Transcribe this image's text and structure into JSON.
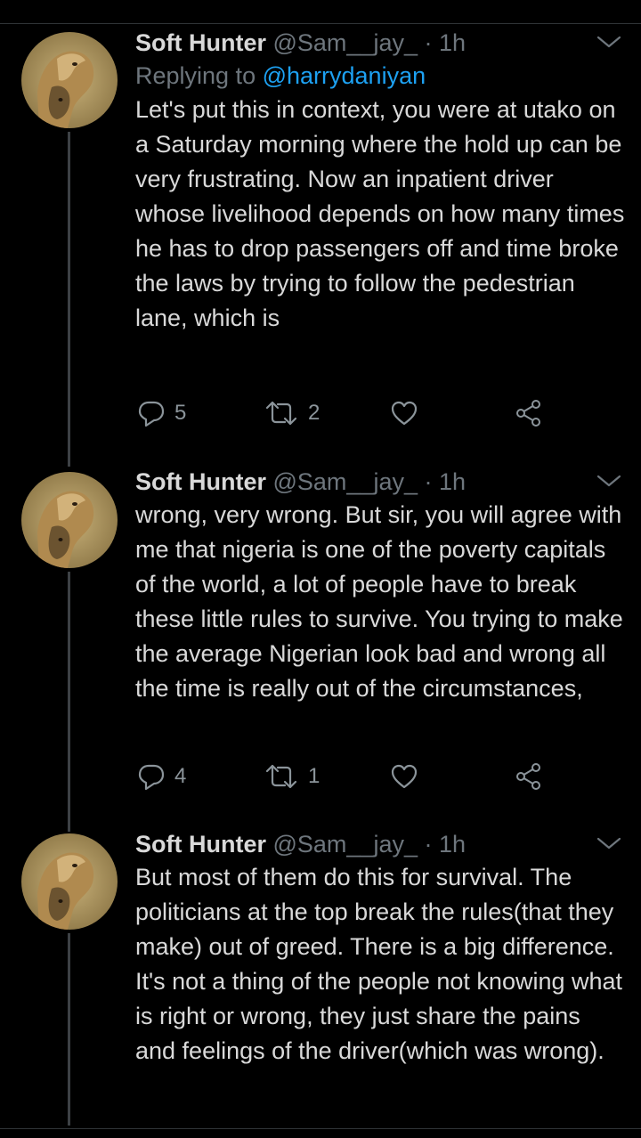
{
  "tweets": [
    {
      "name": "Soft Hunter",
      "handle": "@Sam__jay_",
      "dot": "·",
      "time": "1h",
      "replying_prefix": "Replying to ",
      "replying_to": "@harrydaniyan",
      "text": "Let's put this in context, you were at utako on a Saturday morning where the hold up can be very frustrating. Now an inpatient driver whose livelihood depends on how many times he has to drop passengers off and time broke the laws by trying to follow the pedestrian lane, which is",
      "reply_count": "5",
      "retweet_count": "2"
    },
    {
      "name": "Soft Hunter",
      "handle": "@Sam__jay_",
      "dot": "·",
      "time": "1h",
      "text": "wrong, very wrong. But sir, you will agree with me that nigeria is one of the poverty capitals of the world, a lot of people have to break these little rules to survive. You trying to make the average Nigerian look bad and wrong all the time is really out of the circumstances,",
      "reply_count": "4",
      "retweet_count": "1"
    },
    {
      "name": "Soft Hunter",
      "handle": "@Sam__jay_",
      "dot": "·",
      "time": "1h",
      "text": "But most of them do this for survival. The politicians at the top break the rules(that they make) out of greed. There is a big difference. It's not a thing of the people not knowing what is right or wrong, they just share the pains and feelings of the driver(which was wrong)."
    }
  ],
  "icons": {
    "avatar": "lioness-avatar-icon",
    "more": "chevron-down-icon",
    "reply": "reply-bubble-icon",
    "retweet": "retweet-icon",
    "like": "heart-icon",
    "share": "share-icon"
  },
  "colors": {
    "background": "#000000",
    "text": "#d9d9d9",
    "secondary": "#6e767d",
    "link": "#1da1f2",
    "thread_line": "#3d4145"
  }
}
